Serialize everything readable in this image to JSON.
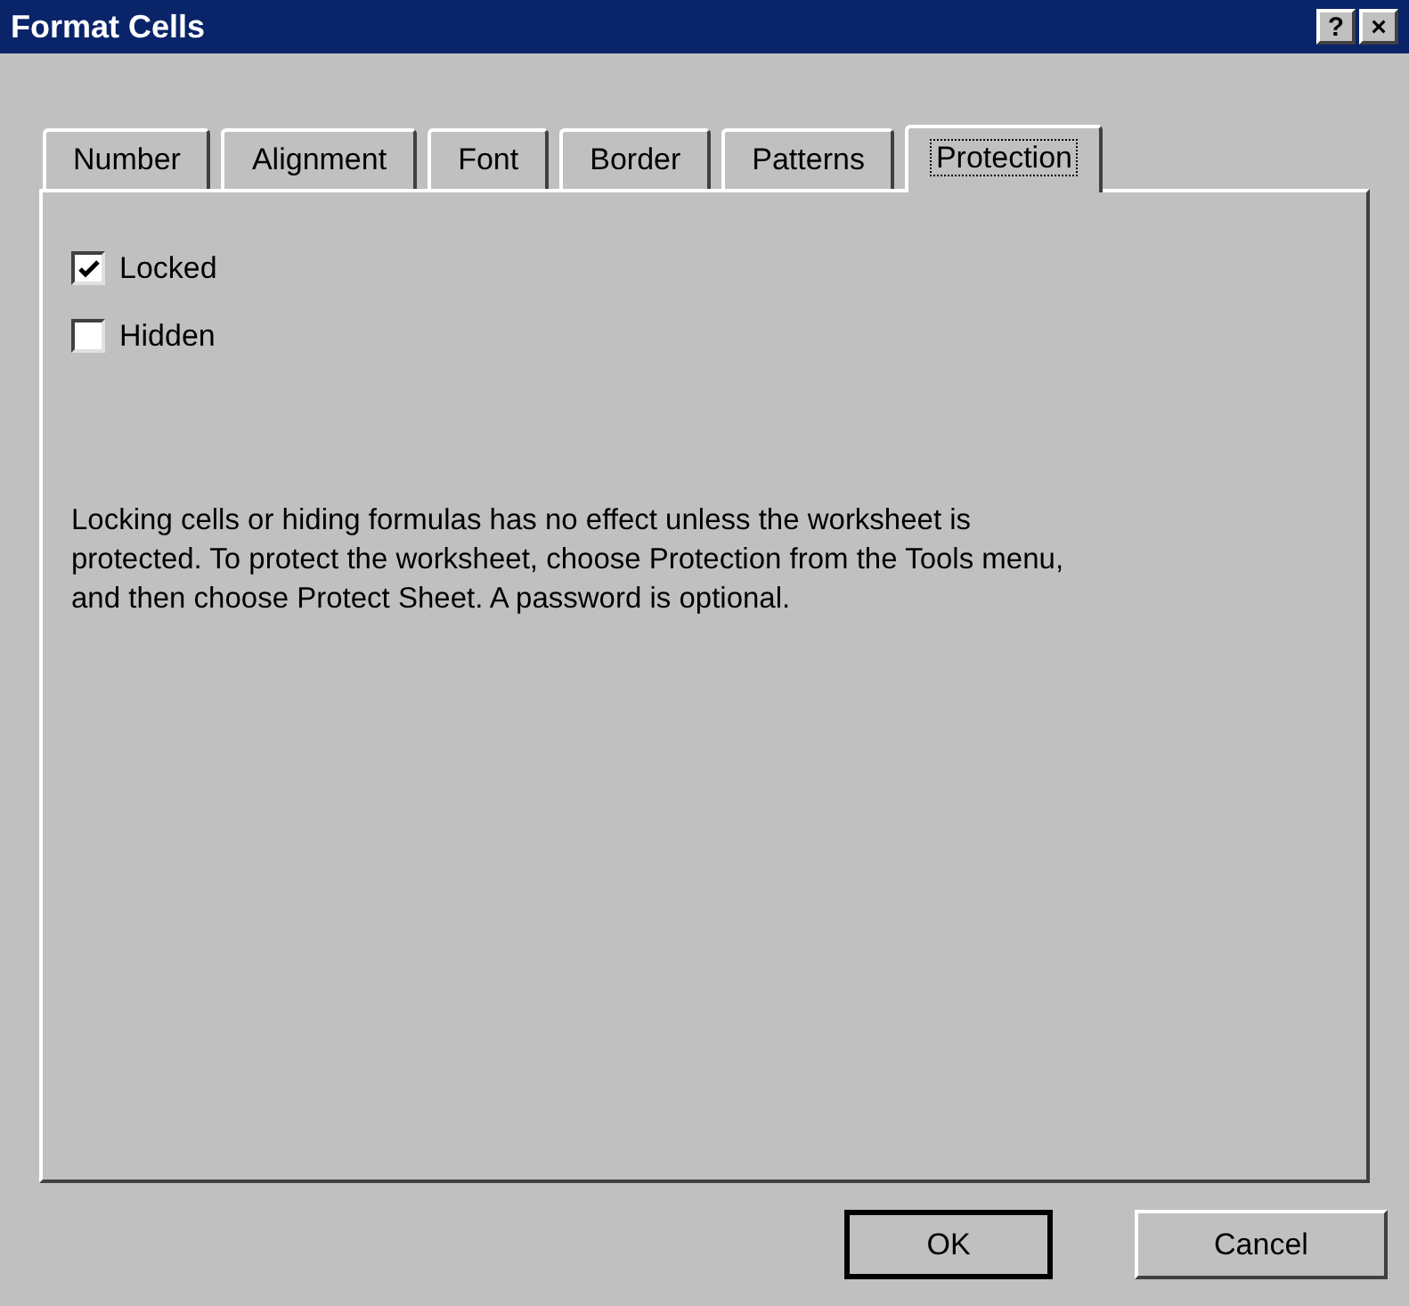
{
  "window": {
    "title": "Format Cells",
    "title_buttons": [
      "?",
      "×"
    ]
  },
  "tabs": [
    {
      "label": "Number",
      "selected": false
    },
    {
      "label": "Alignment",
      "selected": false
    },
    {
      "label": "Font",
      "selected": false
    },
    {
      "label": "Border",
      "selected": false
    },
    {
      "label": "Patterns",
      "selected": false
    },
    {
      "label": "Protection",
      "selected": true
    }
  ],
  "options": [
    {
      "label": "Locked",
      "checked": true
    },
    {
      "label": "Hidden",
      "checked": false
    }
  ],
  "note": "Locking cells or hiding formulas has no effect unless the worksheet is protected. To protect the worksheet, choose Protection from the Tools menu, and then choose Protect Sheet. A password is optional.",
  "buttons": [
    "OK",
    "Cancel"
  ]
}
